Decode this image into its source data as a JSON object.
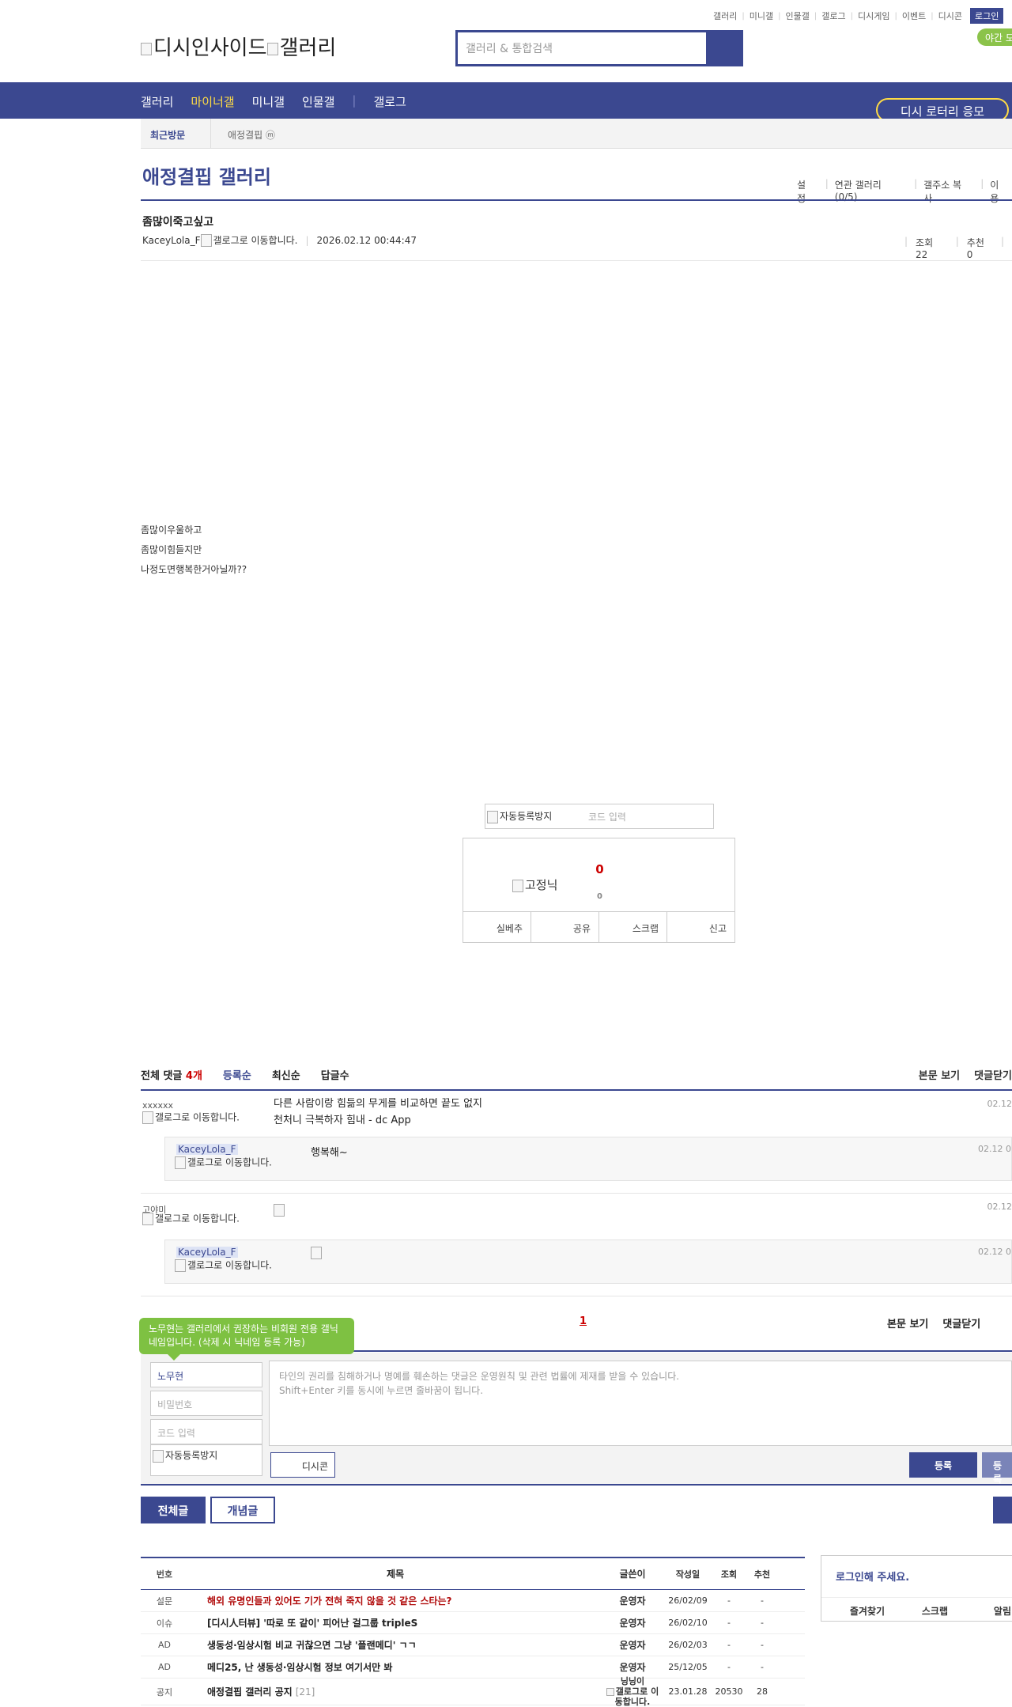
{
  "top_links": [
    "갤러리",
    "미니갤",
    "인물갤",
    "갤로그",
    "디시게임",
    "이벤트",
    "디시콘"
  ],
  "login_label": "로그인",
  "night_mode": "야간 모",
  "logo": {
    "main": "디시인사이드",
    "sub": "갤러리"
  },
  "search": {
    "placeholder": "갤러리 & 통합검색"
  },
  "gnb": {
    "items": [
      "갤러리",
      "마이너갤",
      "미니갤",
      "인물갤"
    ],
    "active": "마이너갤",
    "extra": "갤로그",
    "lottery": "디시 로터리 응모"
  },
  "recent": {
    "label": "최근방문",
    "item": "애정결핍 ⓜ"
  },
  "gallery": {
    "title": "애정결핍 갤러리",
    "tools": [
      "설정",
      "연관 갤러리(0/5)",
      "갤주소 복사",
      "이용"
    ]
  },
  "post": {
    "title": "좀많이죽고싶고",
    "author": "KaceyLola_F",
    "gallog_alt": "갤로그로 이동합니다.",
    "date": "2026.02.12 00:44:47",
    "views": "조회 22",
    "recommend": "추천 0",
    "body": [
      "좀많이우울하고",
      "좀많이힘들지만",
      "나정도면행복한거아닐까??"
    ]
  },
  "captcha": {
    "img_alt": "자동등록방지",
    "placeholder": "코드 입력"
  },
  "recommend_box": {
    "count": "0",
    "fixed_alt": "고정닉",
    "fixed_count": "0",
    "buttons": [
      "실베추",
      "공유",
      "스크랩",
      "신고"
    ]
  },
  "comments": {
    "total_label": "전체 댓글",
    "total_count": "4개",
    "sort_tabs": [
      "등록순",
      "최신순",
      "답글수"
    ],
    "right_links": [
      "본문 보기",
      "댓글닫기"
    ],
    "items": [
      {
        "nick": "xxxxxx",
        "ip_alt": "갤로그로 이동합니다.",
        "text": [
          "다른 사람이랑 힘듦의 무게를 비교하면 끝도 없지",
          "천처니 극복하자 힘내 - dc App"
        ],
        "date": "02.12"
      },
      {
        "nick": "고야미",
        "ip_alt": "갤로그로 이동합니다.",
        "text": [
          ""
        ],
        "date": "02.12"
      }
    ],
    "replies": [
      {
        "nick": "KaceyLola_F",
        "ip_alt": "갤로그로 이동합니다.",
        "text": "행복해~",
        "date": "02.12 0"
      },
      {
        "nick": "KaceyLola_F",
        "ip_alt": "갤로그로 이동합니다.",
        "text": "",
        "date": "02.12 0"
      }
    ],
    "page": "1"
  },
  "write": {
    "tooltip": "노무현는 갤러리에서 권장하는 비회원 전용 갤닉네임입니다. (삭제 시 닉네임 등록 가능)",
    "nickname": "노무현",
    "password_ph": "비밀번호",
    "code_ph": "코드 입력",
    "captcha_alt": "자동등록방지",
    "textarea_ph": [
      "타인의 권리를 침해하거나 명예를 훼손하는 댓글은 운영원칙 및 관련 법률에 제재를 받을 수 있습니다.",
      "Shift+Enter 키를 동시에 누르면 줄바꿈이 됩니다."
    ],
    "dccon": "디시콘",
    "submit": "등록",
    "submit2": "등록"
  },
  "list_buttons": {
    "all": "전체글",
    "best": "개념글"
  },
  "table": {
    "headers": [
      "번호",
      "제목",
      "글쓴이",
      "작성일",
      "조회",
      "추천"
    ],
    "rows": [
      {
        "num": "설문",
        "subject": "해외 유명인들과 있어도 기가 전혀 죽지 않을 것 같은 스타는?",
        "writer": "운영자",
        "date": "26/02/09",
        "views": "-",
        "rec": "-"
      },
      {
        "num": "이슈",
        "subject": "[디시人터뷰] '따로 또 같이' 피어난 걸그룹 tripleS",
        "writer": "운영자",
        "date": "26/02/10",
        "views": "-",
        "rec": "-"
      },
      {
        "num": "AD",
        "subject": "생동성·임상시험 비교 귀찮으면 그냥 '플랜메디' ㄱㄱ",
        "writer": "운영자",
        "date": "26/02/03",
        "views": "-",
        "rec": "-"
      },
      {
        "num": "AD",
        "subject": "메디25, 난 생동성·임상시험 정보 여기서만 봐",
        "writer": "운영자",
        "date": "25/12/05",
        "views": "-",
        "rec": "-"
      },
      {
        "num": "공지",
        "subject": "애정결핍 갤러리 공지",
        "reply": "[21]",
        "writer": "닝닝이",
        "writer_alt": "갤로그로 이동합니다.",
        "date": "23.01.28",
        "views": "20530",
        "rec": "28"
      }
    ]
  },
  "login_box": {
    "msg": "로그인해 주세요.",
    "links": [
      "즐겨찾기",
      "스크랩",
      "알림"
    ]
  }
}
